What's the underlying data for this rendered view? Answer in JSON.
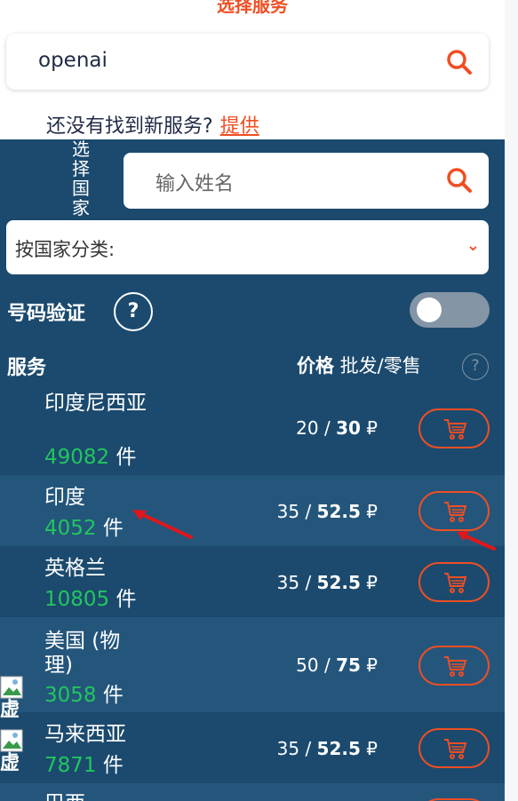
{
  "page_title": "选择服务",
  "search": {
    "value": "openai"
  },
  "suggest": {
    "text": "还没有找到新服务?",
    "link": "提供"
  },
  "country_label": [
    "选",
    "择",
    "国",
    "家"
  ],
  "country_search": {
    "placeholder": "输入姓名"
  },
  "sort": {
    "label": "按国家分类:"
  },
  "verify": {
    "label": "号码验证",
    "help": "?"
  },
  "table_header": {
    "service": "服务",
    "price_bold": "价格",
    "price_rest": " 批发/零售",
    "help": "?"
  },
  "rows": [
    {
      "name": "印度尼西亚",
      "count": "49082",
      "unit": " 件",
      "wholesale": "20",
      "retail": "30",
      "currency": "₽"
    },
    {
      "name": "印度",
      "count": "4052",
      "unit": " 件",
      "wholesale": "35",
      "retail": "52.5",
      "currency": "₽"
    },
    {
      "name": "英格兰",
      "count": "10805",
      "unit": " 件",
      "wholesale": "35",
      "retail": "52.5",
      "currency": "₽"
    },
    {
      "name": "美国 (物理)",
      "count": "3058",
      "unit": " 件",
      "wholesale": "50",
      "retail": "75",
      "currency": "₽"
    },
    {
      "name": "马来西亚",
      "count": "7871",
      "unit": " 件",
      "wholesale": "35",
      "retail": "52.5",
      "currency": "₽"
    },
    {
      "name": "巴西",
      "count": "",
      "unit": "",
      "wholesale": "",
      "retail": "",
      "currency": ""
    }
  ],
  "stray_text": [
    "虚",
    "虚"
  ],
  "colors": {
    "accent": "#f04e23",
    "panel": "#1b4a6e",
    "panel_alt": "#24567c",
    "count": "#22c55e"
  },
  "icons": [
    "search-icon",
    "help-icon",
    "chevron-down-icon",
    "cart-icon",
    "arrow-annotation",
    "broken-image-icon"
  ]
}
